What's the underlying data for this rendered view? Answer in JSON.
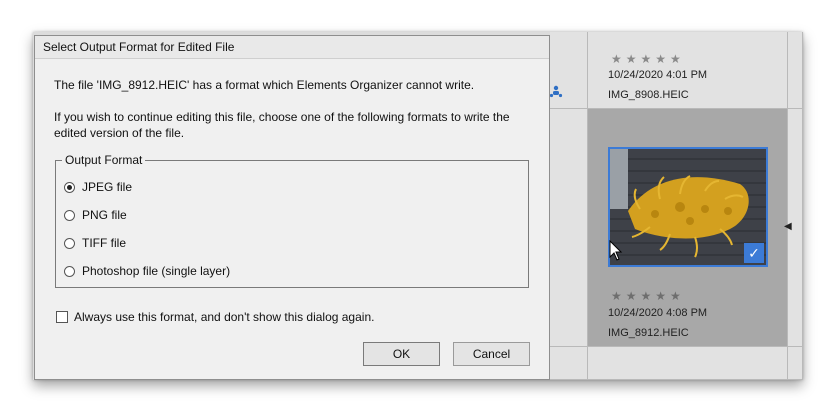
{
  "dialog": {
    "title": "Select Output Format for Edited File",
    "message1": "The file 'IMG_8912.HEIC' has a format which Elements Organizer cannot write.",
    "message2": "If you wish to continue editing this file, choose one of the following formats to write the edited version of the file.",
    "group_label": "Output Format",
    "options": [
      {
        "label": "JPEG file",
        "checked": true
      },
      {
        "label": "PNG file",
        "checked": false
      },
      {
        "label": "TIFF file",
        "checked": false
      },
      {
        "label": "Photoshop file (single layer)",
        "checked": false
      }
    ],
    "remember_label": "Always use this format, and don't show this dialog again.",
    "remember_checked": false,
    "ok_label": "OK",
    "cancel_label": "Cancel"
  },
  "organizer": {
    "items": [
      {
        "stars": "★★★★★",
        "date": "10/24/2020 4:01 PM",
        "name": "IMG_8908.HEIC",
        "selected": false
      },
      {
        "stars": "★★★★★",
        "date": "10/24/2020 4:08 PM",
        "name": "IMG_8912.HEIC",
        "selected": true
      }
    ]
  },
  "colors": {
    "accent": "#3c7bd6",
    "selected_cell": "#a8a8a8",
    "dialog_bg": "#f0f0f0"
  },
  "icons": [
    "people-icon",
    "checkmark-icon",
    "chevron-left-icon",
    "mouse-cursor-icon"
  ]
}
